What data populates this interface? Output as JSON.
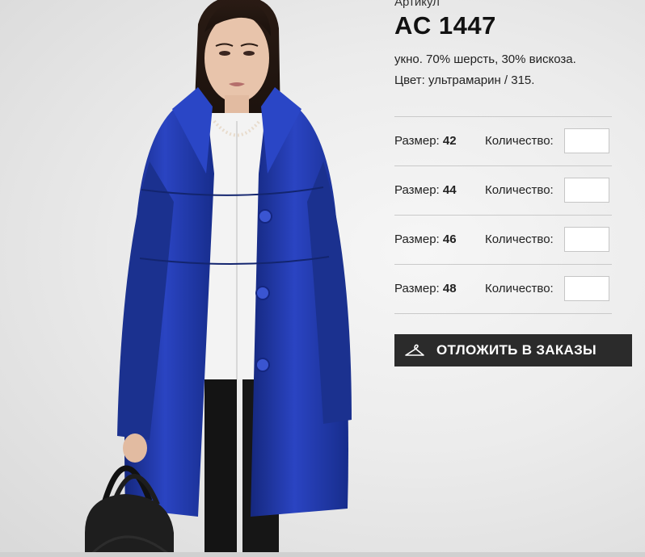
{
  "product": {
    "article_label": "Артикул",
    "article_code": "AC 1447",
    "fabric": "укно. 70% шерсть, 30% вискоза.",
    "color": "Цвет: ультрамарин / 315.",
    "coat_color": "#1f36a8",
    "sizes": [
      {
        "prefix": "Размер:",
        "value": "42",
        "qty_label": "Количество:",
        "qty_value": ""
      },
      {
        "prefix": "Размер:",
        "value": "44",
        "qty_label": "Количество:",
        "qty_value": ""
      },
      {
        "prefix": "Размер:",
        "value": "46",
        "qty_label": "Количество:",
        "qty_value": ""
      },
      {
        "prefix": "Размер:",
        "value": "48",
        "qty_label": "Количество:",
        "qty_value": ""
      }
    ],
    "reserve_button": {
      "label": "ОТЛОЖИТЬ В ЗАКАЗЫ",
      "icon": "hanger-icon",
      "background": "#2b2b2b"
    }
  }
}
